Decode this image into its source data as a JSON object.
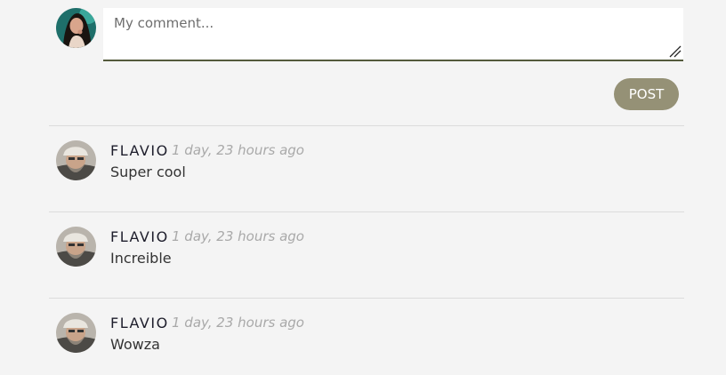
{
  "composer": {
    "placeholder": "My comment...",
    "value": "",
    "post_label": "POST"
  },
  "comments": [
    {
      "author": "FLAVIO",
      "timestamp": "1 day, 23 hours ago",
      "text": "Super cool"
    },
    {
      "author": "FLAVIO",
      "timestamp": "1 day, 23 hours ago",
      "text": "Increible"
    },
    {
      "author": "FLAVIO",
      "timestamp": "1 day, 23 hours ago",
      "text": "Wowza"
    }
  ],
  "colors": {
    "background": "#f4f4f4",
    "post_button": "#959176",
    "input_underline": "#545a3c",
    "author": "#1d1d2b",
    "timestamp": "#a9a9a9",
    "divider": "#dcdcdc"
  },
  "icons": {
    "composer_avatar": "user-avatar-photo",
    "comment_avatar": "flavio-avatar-photo",
    "resize": "resize-handle-icon"
  }
}
